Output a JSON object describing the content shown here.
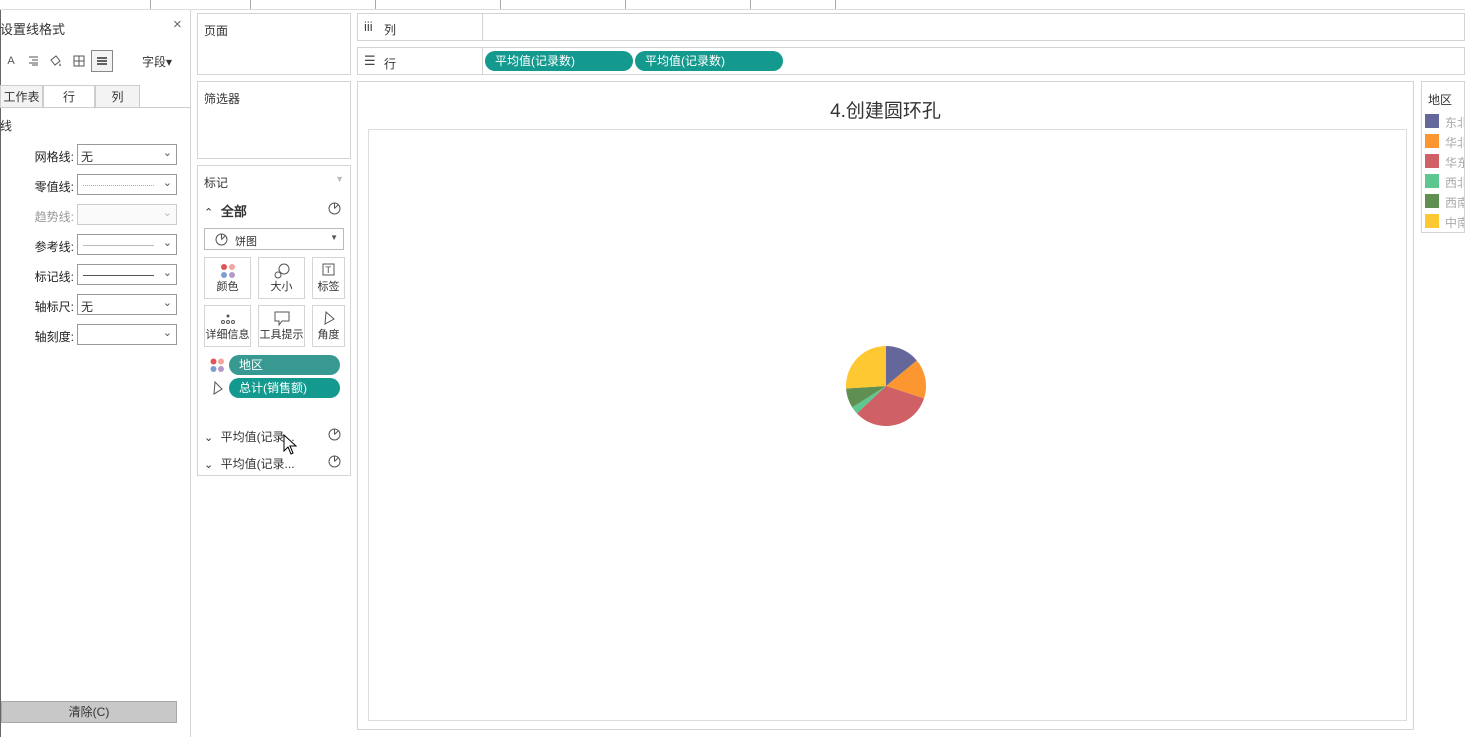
{
  "format_pane": {
    "title": "设置线格式",
    "close": "×",
    "toolbar_icons": [
      "font-icon",
      "align-icon",
      "shading-icon",
      "borders-icon",
      "lines-icon"
    ],
    "fields_label": "字段▾",
    "tabs": [
      "工作表",
      "行",
      "列"
    ],
    "active_tab": "行",
    "section": "线",
    "rows": [
      {
        "label": "网格线:",
        "value": "无",
        "style": "text"
      },
      {
        "label": "零值线:",
        "value": "",
        "style": "dotted"
      },
      {
        "label": "趋势线:",
        "value": "",
        "style": "disabled"
      },
      {
        "label": "参考线:",
        "value": "",
        "style": "thin"
      },
      {
        "label": "标记线:",
        "value": "",
        "style": "solid"
      },
      {
        "label": "轴标尺:",
        "value": "无",
        "style": "text"
      },
      {
        "label": "轴刻度:",
        "value": "",
        "style": "text"
      }
    ],
    "clear_label": "清除(C)"
  },
  "pages_card": {
    "title": "页面"
  },
  "filters_card": {
    "title": "筛选器"
  },
  "marks_card": {
    "title": "标记",
    "all_label": "全部",
    "mark_type": "饼图",
    "buttons": [
      "颜色",
      "大小",
      "标签",
      "详细信息",
      "工具提示",
      "角度"
    ],
    "pills": [
      {
        "label": "地区",
        "kind": "dimension",
        "encoding": "color"
      },
      {
        "label": "总计(销售额)",
        "kind": "measure",
        "encoding": "angle"
      }
    ],
    "sub_marks": [
      "平均值(记录...",
      "平均值(记录..."
    ]
  },
  "columns_shelf": {
    "icon": "iii",
    "label": "列"
  },
  "rows_shelf": {
    "icon": "☰",
    "label": "行",
    "pills": [
      "平均值(记录数)",
      "平均值(记录数)"
    ]
  },
  "view": {
    "title": "4.创建圆环孔"
  },
  "legend": {
    "title": "地区",
    "items": [
      {
        "label": "东北",
        "color": "#65669a"
      },
      {
        "label": "华北",
        "color": "#fb9631"
      },
      {
        "label": "华东",
        "color": "#cf6065"
      },
      {
        "label": "西北",
        "color": "#5ec790"
      },
      {
        "label": "西南",
        "color": "#609051"
      },
      {
        "label": "中南",
        "color": "#fdc832"
      }
    ]
  },
  "chart_data": {
    "type": "pie",
    "categories": [
      "东北",
      "华北",
      "华东",
      "西北",
      "西南",
      "中南"
    ],
    "values": [
      14,
      16,
      33,
      3,
      8,
      26
    ],
    "title": "4.创建圆环孔"
  }
}
